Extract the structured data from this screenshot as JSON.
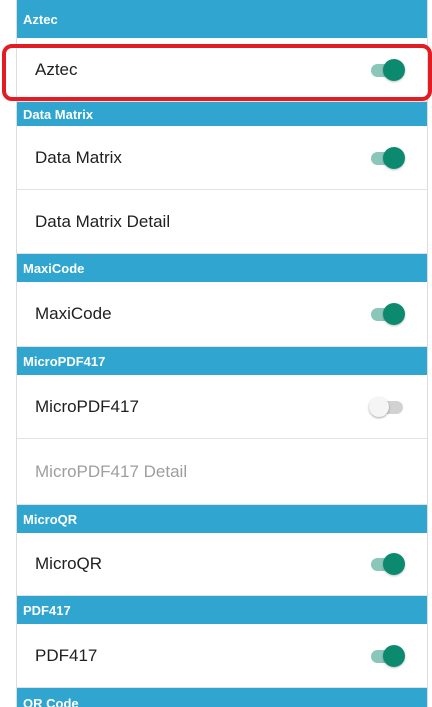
{
  "sections": [
    {
      "header": "Aztec",
      "rows": [
        {
          "label": "Aztec",
          "toggle": "on"
        }
      ]
    },
    {
      "header": "Data Matrix",
      "rows": [
        {
          "label": "Data Matrix",
          "toggle": "on"
        },
        {
          "label": "Data Matrix Detail",
          "toggle": null
        }
      ]
    },
    {
      "header": "MaxiCode",
      "rows": [
        {
          "label": "MaxiCode",
          "toggle": "on"
        }
      ]
    },
    {
      "header": "MicroPDF417",
      "rows": [
        {
          "label": "MicroPDF417",
          "toggle": "off"
        },
        {
          "label": "MicroPDF417 Detail",
          "toggle": null,
          "disabled": true
        }
      ]
    },
    {
      "header": "MicroQR",
      "rows": [
        {
          "label": "MicroQR",
          "toggle": "on"
        }
      ]
    },
    {
      "header": "PDF417",
      "rows": [
        {
          "label": "PDF417",
          "toggle": "on"
        }
      ]
    },
    {
      "header": "QR Code",
      "rows": []
    }
  ],
  "colors": {
    "section_header_bg": "#2fa5cf",
    "toggle_on_thumb": "#0c8a6f",
    "toggle_on_track": "#8ac6b9",
    "highlight_border": "#e31b23"
  }
}
